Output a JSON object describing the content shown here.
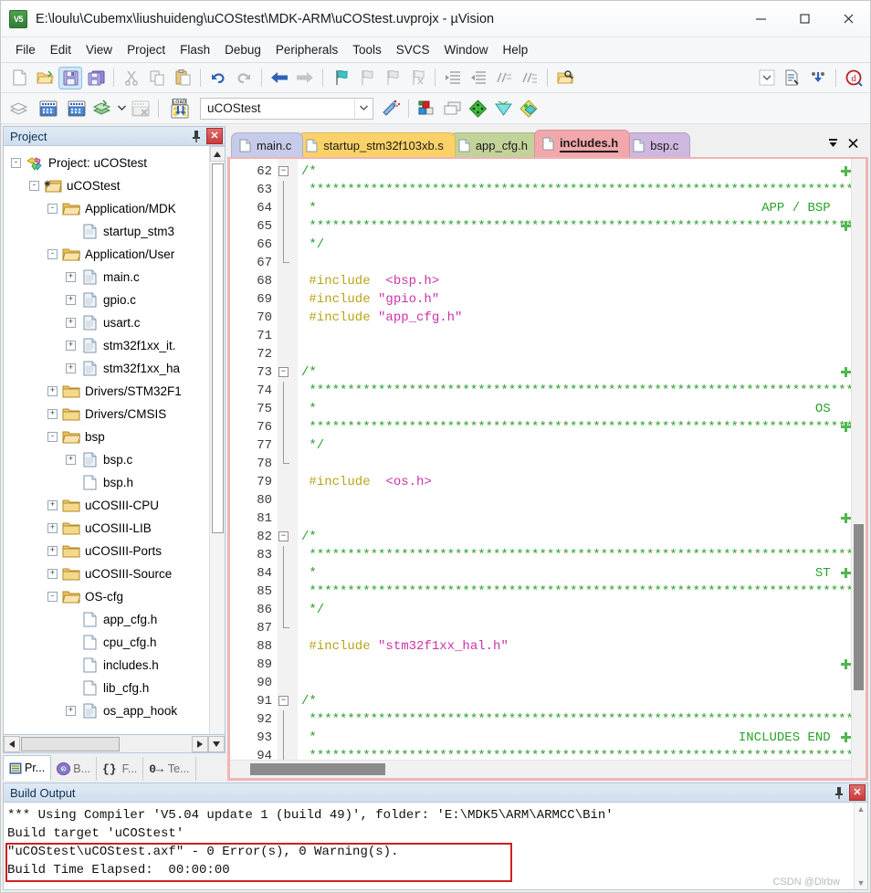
{
  "window": {
    "title": "E:\\loulu\\Cubemx\\liushuideng\\uCOStest\\MDK-ARM\\uCOStest.uvprojx - µVision",
    "app_icon_label": "V5",
    "minimize": "─",
    "maximize": "□",
    "close": "✕"
  },
  "menubar": {
    "items": [
      {
        "label": "File"
      },
      {
        "label": "Edit"
      },
      {
        "label": "View"
      },
      {
        "label": "Project"
      },
      {
        "label": "Flash"
      },
      {
        "label": "Debug"
      },
      {
        "label": "Peripherals"
      },
      {
        "label": "Tools"
      },
      {
        "label": "SVCS"
      },
      {
        "label": "Window"
      },
      {
        "label": "Help"
      }
    ]
  },
  "toolbar_main": {
    "buttons": [
      {
        "name": "new-file-icon",
        "glyph": "new"
      },
      {
        "name": "open-file-icon",
        "glyph": "open"
      },
      {
        "name": "save-icon",
        "glyph": "save",
        "pressed": true
      },
      {
        "name": "save-all-icon",
        "glyph": "saveall"
      },
      {
        "name": "cut-icon",
        "glyph": "cut"
      },
      {
        "name": "copy-icon",
        "glyph": "copy"
      },
      {
        "name": "paste-icon",
        "glyph": "paste"
      },
      {
        "name": "undo-icon",
        "glyph": "undo"
      },
      {
        "name": "redo-icon",
        "glyph": "redo"
      },
      {
        "name": "navigate-back-icon",
        "glyph": "back"
      },
      {
        "name": "navigate-forward-icon",
        "glyph": "forward"
      },
      {
        "name": "bookmark-toggle-icon",
        "glyph": "bm"
      },
      {
        "name": "bookmark-prev-icon",
        "glyph": "bmprev"
      },
      {
        "name": "bookmark-next-icon",
        "glyph": "bmnext"
      },
      {
        "name": "bookmark-clear-icon",
        "glyph": "bmclear"
      },
      {
        "name": "indent-icon",
        "glyph": "indent"
      },
      {
        "name": "outdent-icon",
        "glyph": "outdent"
      },
      {
        "name": "comment-icon",
        "glyph": "comment"
      },
      {
        "name": "uncomment-icon",
        "glyph": "uncomment"
      },
      {
        "name": "find-in-files-icon",
        "glyph": "findfiles"
      }
    ],
    "right_buttons": [
      {
        "name": "config-dropdown-icon",
        "glyph": "chev"
      },
      {
        "name": "build-log-icon",
        "glyph": "buildlog"
      },
      {
        "name": "debug-icon",
        "glyph": "dbg"
      },
      {
        "name": "start-debug-icon",
        "glyph": "startdbg"
      }
    ]
  },
  "toolbar_build": {
    "buttons": [
      {
        "name": "translate-icon",
        "glyph": "translate"
      },
      {
        "name": "build-target-icon",
        "glyph": "build",
        "highlighted": true
      },
      {
        "name": "rebuild-all-icon",
        "glyph": "rebuild"
      },
      {
        "name": "batch-build-icon",
        "glyph": "batch"
      },
      {
        "name": "stop-build-icon",
        "glyph": "stopbuild"
      },
      {
        "name": "download-icon",
        "glyph": "load",
        "highlighted": true
      }
    ],
    "target_value": "uCOStest",
    "right_buttons": [
      {
        "name": "target-options-icon",
        "glyph": "magic"
      },
      {
        "name": "manage-run-time-env-icon",
        "glyph": "blocks"
      },
      {
        "name": "select-software-packs-icon",
        "glyph": "packs"
      },
      {
        "name": "manage-project-items-icon",
        "glyph": "green-diamond"
      },
      {
        "name": "multi-project-icon",
        "glyph": "cyan-diamond"
      },
      {
        "name": "pack-installer-icon",
        "glyph": "pack-inst"
      }
    ]
  },
  "project_pane": {
    "title": "Project",
    "pin_label": "⚐",
    "close_label": "✕",
    "tree": [
      {
        "label": "Project: uCOStest",
        "depth": 0,
        "expander": "-",
        "icon": "project-icon"
      },
      {
        "label": "uCOStest",
        "depth": 1,
        "expander": "-",
        "icon": "target-folder-icon"
      },
      {
        "label": "Application/MDK",
        "depth": 2,
        "expander": "-",
        "icon": "group-folder-icon"
      },
      {
        "label": "startup_stm3",
        "depth": 3,
        "expander": "",
        "icon": "asm-file-icon"
      },
      {
        "label": "Application/User",
        "depth": 2,
        "expander": "-",
        "icon": "group-folder-icon"
      },
      {
        "label": "main.c",
        "depth": 3,
        "expander": "+",
        "icon": "c-file-icon"
      },
      {
        "label": "gpio.c",
        "depth": 3,
        "expander": "+",
        "icon": "c-file-icon"
      },
      {
        "label": "usart.c",
        "depth": 3,
        "expander": "+",
        "icon": "c-file-icon"
      },
      {
        "label": "stm32f1xx_it.",
        "depth": 3,
        "expander": "+",
        "icon": "c-file-icon"
      },
      {
        "label": "stm32f1xx_ha",
        "depth": 3,
        "expander": "+",
        "icon": "c-file-icon"
      },
      {
        "label": "Drivers/STM32F1",
        "depth": 2,
        "expander": "+",
        "icon": "group-folder-closed-icon"
      },
      {
        "label": "Drivers/CMSIS",
        "depth": 2,
        "expander": "+",
        "icon": "group-folder-closed-icon"
      },
      {
        "label": "bsp",
        "depth": 2,
        "expander": "-",
        "icon": "group-folder-icon"
      },
      {
        "label": "bsp.c",
        "depth": 3,
        "expander": "+",
        "icon": "c-file-icon"
      },
      {
        "label": "bsp.h",
        "depth": 3,
        "expander": "",
        "icon": "h-file-icon"
      },
      {
        "label": "uCOSIII-CPU",
        "depth": 2,
        "expander": "+",
        "icon": "group-folder-closed-icon"
      },
      {
        "label": "uCOSIII-LIB",
        "depth": 2,
        "expander": "+",
        "icon": "group-folder-closed-icon"
      },
      {
        "label": "uCOSIII-Ports",
        "depth": 2,
        "expander": "+",
        "icon": "group-folder-closed-icon"
      },
      {
        "label": "uCOSIII-Source",
        "depth": 2,
        "expander": "+",
        "icon": "group-folder-closed-icon"
      },
      {
        "label": "OS-cfg",
        "depth": 2,
        "expander": "-",
        "icon": "group-folder-icon"
      },
      {
        "label": "app_cfg.h",
        "depth": 3,
        "expander": "",
        "icon": "h-file-icon"
      },
      {
        "label": "cpu_cfg.h",
        "depth": 3,
        "expander": "",
        "icon": "h-file-icon"
      },
      {
        "label": "includes.h",
        "depth": 3,
        "expander": "",
        "icon": "h-file-icon"
      },
      {
        "label": "lib_cfg.h",
        "depth": 3,
        "expander": "",
        "icon": "h-file-icon"
      },
      {
        "label": "os_app_hook",
        "depth": 3,
        "expander": "+",
        "icon": "c-file-icon"
      }
    ],
    "bottom_tabs": [
      {
        "label": "Pr...",
        "icon": "project-tab-icon",
        "selected": true
      },
      {
        "label": "B...",
        "icon": "books-tab-icon",
        "selected": false
      },
      {
        "label": "F...",
        "icon": "functions-tab-icon",
        "selected": false
      },
      {
        "label": "Te...",
        "icon": "templates-tab-icon",
        "selected": false
      }
    ]
  },
  "editor": {
    "tabs": [
      {
        "label": "main.c",
        "color": "#c5cbe8",
        "active": false
      },
      {
        "label": "startup_stm32f103xb.s",
        "color": "#fbd268",
        "active": false
      },
      {
        "label": "app_cfg.h",
        "color": "#c2d39a",
        "active": false
      },
      {
        "label": "includes.h",
        "color": "#f2a8ab",
        "active": true
      },
      {
        "label": "bsp.c",
        "color": "#cfb8e0",
        "active": false
      }
    ],
    "tab_menu_icon": "▼",
    "tab_close_icon": "✕",
    "first_line_number": 62,
    "lines": [
      {
        "n": 62,
        "fold": "start",
        "tokens": [
          {
            "t": "/*",
            "c": "comment"
          }
        ]
      },
      {
        "n": 63,
        "fold": "bar",
        "tokens": [
          {
            "t": " **************************************************************************",
            "c": "comment"
          }
        ]
      },
      {
        "n": 64,
        "fold": "bar",
        "tokens": [
          {
            "t": " *                                                          APP / BSP",
            "c": "comment"
          }
        ]
      },
      {
        "n": 65,
        "fold": "bar",
        "tokens": [
          {
            "t": " **************************************************************************",
            "c": "comment"
          }
        ]
      },
      {
        "n": 66,
        "fold": "bar",
        "tokens": [
          {
            "t": " */",
            "c": "comment"
          }
        ]
      },
      {
        "n": 67,
        "fold": "end",
        "tokens": []
      },
      {
        "n": 68,
        "fold": "none",
        "tokens": [
          {
            "t": " #include  ",
            "c": "pre"
          },
          {
            "t": "<bsp.h>",
            "c": "str"
          }
        ]
      },
      {
        "n": 69,
        "fold": "none",
        "tokens": [
          {
            "t": " #include ",
            "c": "pre"
          },
          {
            "t": "\"gpio.h\"",
            "c": "str"
          }
        ]
      },
      {
        "n": 70,
        "fold": "none",
        "tokens": [
          {
            "t": " #include ",
            "c": "pre"
          },
          {
            "t": "\"app_cfg.h\"",
            "c": "str"
          }
        ]
      },
      {
        "n": 71,
        "fold": "none",
        "tokens": []
      },
      {
        "n": 72,
        "fold": "none",
        "tokens": []
      },
      {
        "n": 73,
        "fold": "start",
        "tokens": [
          {
            "t": "/*",
            "c": "comment"
          }
        ]
      },
      {
        "n": 74,
        "fold": "bar",
        "tokens": [
          {
            "t": " **************************************************************************",
            "c": "comment"
          }
        ]
      },
      {
        "n": 75,
        "fold": "bar",
        "tokens": [
          {
            "t": " *                                                                 OS",
            "c": "comment"
          }
        ]
      },
      {
        "n": 76,
        "fold": "bar",
        "tokens": [
          {
            "t": " **************************************************************************",
            "c": "comment"
          }
        ]
      },
      {
        "n": 77,
        "fold": "bar",
        "tokens": [
          {
            "t": " */",
            "c": "comment"
          }
        ]
      },
      {
        "n": 78,
        "fold": "end",
        "tokens": []
      },
      {
        "n": 79,
        "fold": "none",
        "tokens": [
          {
            "t": " #include  ",
            "c": "pre"
          },
          {
            "t": "<os.h>",
            "c": "str"
          }
        ]
      },
      {
        "n": 80,
        "fold": "none",
        "tokens": []
      },
      {
        "n": 81,
        "fold": "none",
        "tokens": []
      },
      {
        "n": 82,
        "fold": "start",
        "tokens": [
          {
            "t": "/*",
            "c": "comment"
          }
        ]
      },
      {
        "n": 83,
        "fold": "bar",
        "tokens": [
          {
            "t": " **************************************************************************",
            "c": "comment"
          }
        ]
      },
      {
        "n": 84,
        "fold": "bar",
        "tokens": [
          {
            "t": " *                                                                 ST",
            "c": "comment"
          }
        ]
      },
      {
        "n": 85,
        "fold": "bar",
        "tokens": [
          {
            "t": " **************************************************************************",
            "c": "comment"
          }
        ]
      },
      {
        "n": 86,
        "fold": "bar",
        "tokens": [
          {
            "t": " */",
            "c": "comment"
          }
        ]
      },
      {
        "n": 87,
        "fold": "end",
        "tokens": []
      },
      {
        "n": 88,
        "fold": "none",
        "tokens": [
          {
            "t": " #include ",
            "c": "pre"
          },
          {
            "t": "\"stm32f1xx_hal.h\"",
            "c": "str"
          }
        ]
      },
      {
        "n": 89,
        "fold": "none",
        "tokens": []
      },
      {
        "n": 90,
        "fold": "none",
        "tokens": []
      },
      {
        "n": 91,
        "fold": "start",
        "tokens": [
          {
            "t": "/*",
            "c": "comment"
          }
        ]
      },
      {
        "n": 92,
        "fold": "bar",
        "tokens": [
          {
            "t": " **************************************************************************",
            "c": "comment"
          }
        ]
      },
      {
        "n": 93,
        "fold": "bar",
        "tokens": [
          {
            "t": " *                                                       INCLUDES END",
            "c": "comment"
          }
        ]
      },
      {
        "n": 94,
        "fold": "bar",
        "tokens": [
          {
            "t": " **************************************************************************",
            "c": "comment"
          }
        ]
      }
    ]
  },
  "build_output": {
    "title": "Build Output",
    "pin_label": "⚐",
    "close_label": "✕",
    "lines": [
      "*** Using Compiler 'V5.04 update 1 (build 49)', folder: 'E:\\MDK5\\ARM\\ARMCC\\Bin'",
      "Build target 'uCOStest'",
      "\"uCOStest\\uCOStest.axf\" - 0 Error(s), 0 Warning(s).",
      "Build Time Elapsed:  00:00:00"
    ],
    "watermark": "CSDN @Dlrbw"
  },
  "colors": {
    "highlight_red": "#d02020",
    "comment_green": "#2aa02a",
    "preprocessor": "#b8a419",
    "string_magenta": "#cc33aa",
    "pane_header_blue": "#cfdeee",
    "active_tab_pink": "#f2a8ab"
  }
}
